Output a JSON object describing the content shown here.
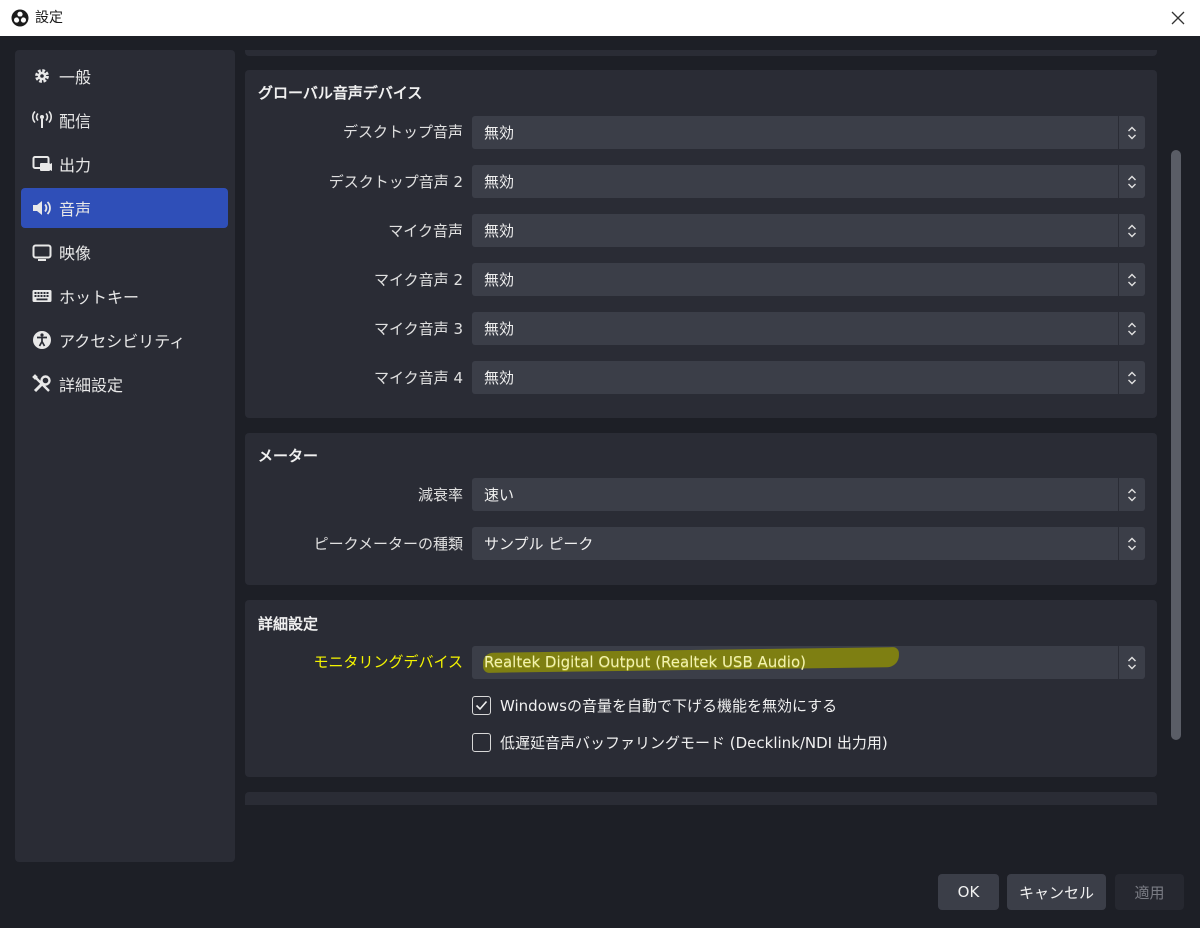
{
  "window": {
    "title": "設定"
  },
  "sidebar": {
    "items": [
      {
        "label": "一般",
        "icon": "gear-icon"
      },
      {
        "label": "配信",
        "icon": "broadcast-icon"
      },
      {
        "label": "出力",
        "icon": "output-icon"
      },
      {
        "label": "音声",
        "icon": "speaker-icon",
        "active": true
      },
      {
        "label": "映像",
        "icon": "monitor-icon"
      },
      {
        "label": "ホットキー",
        "icon": "keyboard-icon"
      },
      {
        "label": "アクセシビリティ",
        "icon": "accessibility-icon"
      },
      {
        "label": "詳細設定",
        "icon": "tools-icon"
      }
    ]
  },
  "global_audio": {
    "title": "グローバル音声デバイス",
    "rows": [
      {
        "label": "デスクトップ音声",
        "value": "無効"
      },
      {
        "label": "デスクトップ音声 2",
        "value": "無効"
      },
      {
        "label": "マイク音声",
        "value": "無効"
      },
      {
        "label": "マイク音声 2",
        "value": "無効"
      },
      {
        "label": "マイク音声 3",
        "value": "無効"
      },
      {
        "label": "マイク音声 4",
        "value": "無効"
      }
    ]
  },
  "meter": {
    "title": "メーター",
    "rows": [
      {
        "label": "減衰率",
        "value": "速い"
      },
      {
        "label": "ピークメーターの種類",
        "value": "サンプル ピーク"
      }
    ]
  },
  "advanced": {
    "title": "詳細設定",
    "monitoring_label": "モニタリングデバイス",
    "monitoring_value": "Realtek Digital Output (Realtek USB Audio)",
    "checkbox1": {
      "label": "Windowsの音量を自動で下げる機能を無効にする",
      "checked": true
    },
    "checkbox2": {
      "label": "低遅延音声バッファリングモード (Decklink/NDI 出力用)",
      "checked": false
    }
  },
  "buttons": {
    "ok": "OK",
    "cancel": "キャンセル",
    "apply": "適用"
  },
  "colors": {
    "accent": "#2f4fb8",
    "highlight_text": "#f4f400"
  }
}
